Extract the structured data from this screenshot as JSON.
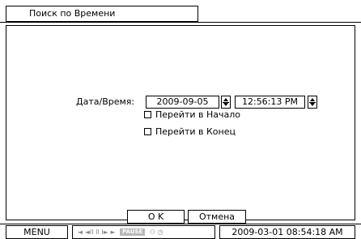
{
  "dialog": {
    "title": "Поиск по Времени",
    "datetime_label": "Дата/Время:",
    "date_value": "2009-09-05",
    "time_value": "12:56:13 PM",
    "goto_start_label": "Перейти в Начало",
    "goto_end_label": "Перейти в Конец",
    "ok_label": "O K",
    "cancel_label": "Отмена"
  },
  "statusbar": {
    "menu_label": "MENU",
    "controls_text": "◄ ◄II II I► ►",
    "pause_label": "PAUSE",
    "misc_icons": "⚇ ◷",
    "datetime": "2009-03-01  08:54:18 AM"
  }
}
